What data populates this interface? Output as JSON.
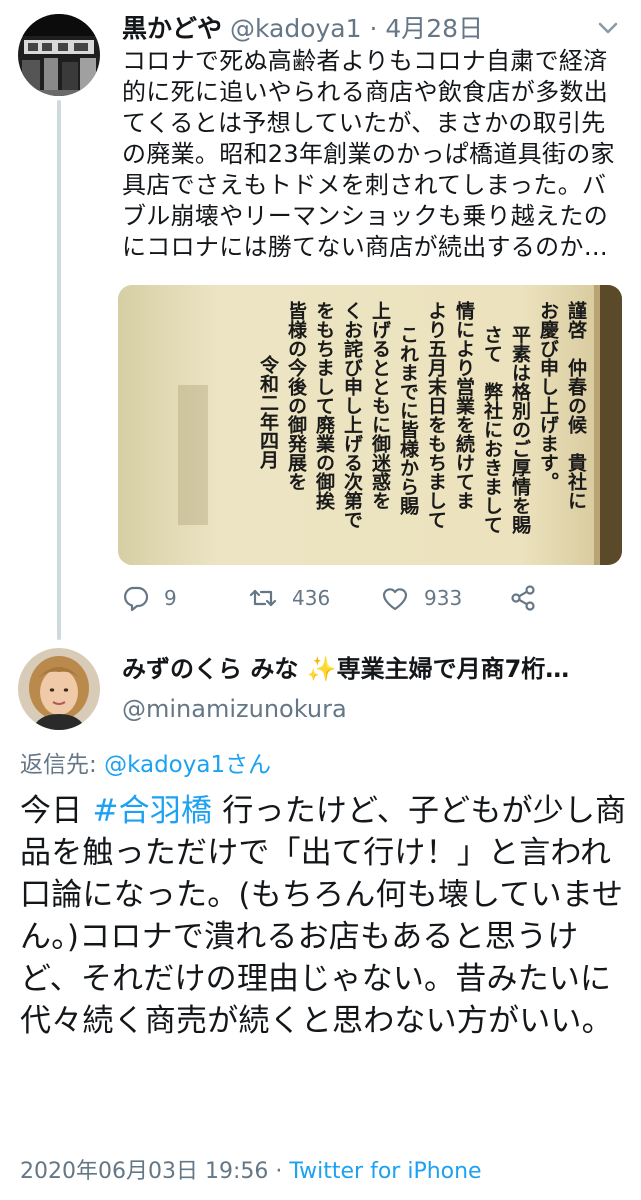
{
  "parent_tweet": {
    "display_name": "黒かどや",
    "handle": "@kadoya1",
    "separator": " · ",
    "date": "4月28日",
    "text": "コロナで死ぬ高齢者よりもコロナ自粛で経済的に死に追いやられる商店や飲食店が多数出てくるとは予想していたが、まさかの取引先の廃業。昭和23年創業のかっぱ橋道具街の家具店でさえもトドメを刺されてしまった。バブル崩壊やリーマンショックも乗り越えたのにコロナには勝てない商店が続出するのか…",
    "image_text": {
      "col1": "謹啓　仲春の候　貴社に",
      "col2": "お慶び申し上げます。",
      "col3": "平素は格別のご厚情を賜",
      "col4": "さて　弊社におきまして",
      "col5": "情により営業を続けてま",
      "col6": "より五月末日をもちまして",
      "col7": "これまでに皆様から賜",
      "col8": "上げるとともに御迷惑を",
      "col9": "くお詫び申し上げる次第で",
      "col10": "をもちまして廃業の御挨",
      "col11": "皆様の今後の御発展を",
      "col12": "令和二年四月"
    },
    "actions": {
      "replies": "9",
      "retweets": "436",
      "likes": "933"
    }
  },
  "reply_tweet": {
    "display_name": "みずのくら みな",
    "sparkle": "✨",
    "name_suffix": "専業主婦で月商7桁…",
    "handle": "@minamizunokura",
    "replying_label": "返信先: ",
    "replying_to": "@kadoya1さん",
    "text_before": "今日 ",
    "hashtag": "#合羽橋",
    "text_after": " 行ったけど、子どもが少し商品を触っただけで「出て行け！」と言われ口論になった。(もちろん何も壊していません。)コロナで潰れるお店もあると思うけど、それだけの理由じゃない。昔みたいに代々続く商売が続くと思わない方がいい。",
    "timestamp": "2020年06月03日 19:56",
    "meta_separator": " · ",
    "client": "Twitter for iPhone"
  },
  "colors": {
    "link_blue": "#1da1f2",
    "secondary_gray": "#657786",
    "thread_line": "#cfd9de",
    "paper": "#e6dbb4"
  },
  "icons": [
    "reply-icon",
    "retweet-icon",
    "like-icon",
    "share-icon",
    "chevron-down-icon"
  ]
}
